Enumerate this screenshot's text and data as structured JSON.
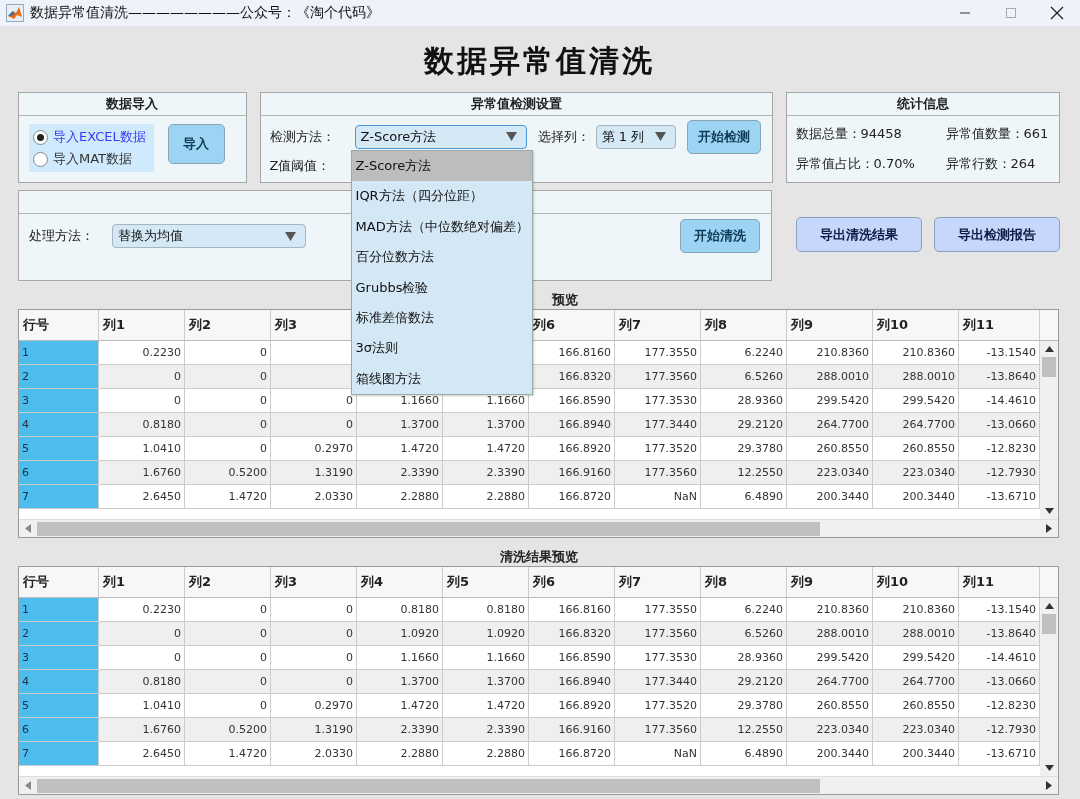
{
  "window": {
    "title": "数据异常值清洗————————公众号：《淘个代码》"
  },
  "heading": "数据异常值清洗",
  "import_panel": {
    "title": "数据导入",
    "options": [
      {
        "label": "导入EXCEL数据",
        "selected": true
      },
      {
        "label": "导入MAT数据",
        "selected": false
      }
    ],
    "button": "导入"
  },
  "detect_panel": {
    "title": "异常值检测设置",
    "method_label": "检测方法：",
    "method_value": "Z-Score方法",
    "column_label": "选择列：",
    "column_value": "第 1 列",
    "threshold_label": "Z值阈值：",
    "button": "开始检测",
    "dropdown": {
      "expanded": true,
      "options": [
        {
          "label": "Z-Score方法",
          "selected": true
        },
        {
          "label": "IQR方法（四分位距）",
          "selected": false
        },
        {
          "label": "MAD方法（中位数绝对偏差）",
          "selected": false
        },
        {
          "label": "百分位数方法",
          "selected": false
        },
        {
          "label": "Grubbs检验",
          "selected": false
        },
        {
          "label": "标准差倍数法",
          "selected": false
        },
        {
          "label": "3σ法则",
          "selected": false
        },
        {
          "label": "箱线图方法",
          "selected": false
        }
      ]
    }
  },
  "clean_panel": {
    "method_label": "处理方法：",
    "method_value": "替换为均值",
    "button": "开始清洗"
  },
  "stats_panel": {
    "title": "统计信息",
    "items": [
      {
        "label": "数据总量：",
        "value": "94458"
      },
      {
        "label": "异常值数量：",
        "value": "661"
      },
      {
        "label": "异常值占比：",
        "value": "0.70%"
      },
      {
        "label": "异常行数：",
        "value": "264"
      }
    ]
  },
  "export_buttons": [
    "导出清洗结果",
    "导出检测报告"
  ],
  "tables": [
    {
      "title": "预览",
      "columns": [
        "行号",
        "列1",
        "列2",
        "列3",
        null,
        null,
        "列6",
        "列7",
        "列8",
        "列9",
        "列10",
        "列11"
      ],
      "rows": [
        [
          "1",
          "0.2230",
          "0",
          null,
          null,
          null,
          "166.8160",
          "177.3550",
          "6.2240",
          "210.8360",
          "210.8360",
          "-13.1540"
        ],
        [
          "2",
          "0",
          "0",
          null,
          null,
          null,
          "166.8320",
          "177.3560",
          "6.5260",
          "288.0010",
          "288.0010",
          "-13.8640"
        ],
        [
          "3",
          "0",
          "0",
          "0",
          "1.1660",
          "1.1660",
          "166.8590",
          "177.3530",
          "28.9360",
          "299.5420",
          "299.5420",
          "-14.4610"
        ],
        [
          "4",
          "0.8180",
          "0",
          "0",
          "1.3700",
          "1.3700",
          "166.8940",
          "177.3440",
          "29.2120",
          "264.7700",
          "264.7700",
          "-13.0660"
        ],
        [
          "5",
          "1.0410",
          "0",
          "0.2970",
          "1.4720",
          "1.4720",
          "166.8920",
          "177.3520",
          "29.3780",
          "260.8550",
          "260.8550",
          "-12.8230"
        ],
        [
          "6",
          "1.6760",
          "0.5200",
          "1.3190",
          "2.3390",
          "2.3390",
          "166.9160",
          "177.3560",
          "12.2550",
          "223.0340",
          "223.0340",
          "-12.7930"
        ],
        [
          "7",
          "2.6450",
          "1.4720",
          "2.0330",
          "2.2880",
          "2.2880",
          "166.8720",
          "NaN",
          "6.4890",
          "200.3440",
          "200.3440",
          "-13.6710"
        ]
      ]
    },
    {
      "title": "清洗结果预览",
      "columns": [
        "行号",
        "列1",
        "列2",
        "列3",
        "列4",
        "列5",
        "列6",
        "列7",
        "列8",
        "列9",
        "列10",
        "列11"
      ],
      "rows": [
        [
          "1",
          "0.2230",
          "0",
          "0",
          "0.8180",
          "0.8180",
          "166.8160",
          "177.3550",
          "6.2240",
          "210.8360",
          "210.8360",
          "-13.1540"
        ],
        [
          "2",
          "0",
          "0",
          "0",
          "1.0920",
          "1.0920",
          "166.8320",
          "177.3560",
          "6.5260",
          "288.0010",
          "288.0010",
          "-13.8640"
        ],
        [
          "3",
          "0",
          "0",
          "0",
          "1.1660",
          "1.1660",
          "166.8590",
          "177.3530",
          "28.9360",
          "299.5420",
          "299.5420",
          "-14.4610"
        ],
        [
          "4",
          "0.8180",
          "0",
          "0",
          "1.3700",
          "1.3700",
          "166.8940",
          "177.3440",
          "29.2120",
          "264.7700",
          "264.7700",
          "-13.0660"
        ],
        [
          "5",
          "1.0410",
          "0",
          "0.2970",
          "1.4720",
          "1.4720",
          "166.8920",
          "177.3520",
          "29.3780",
          "260.8550",
          "260.8550",
          "-12.8230"
        ],
        [
          "6",
          "1.6760",
          "0.5200",
          "1.3190",
          "2.3390",
          "2.3390",
          "166.9160",
          "177.3560",
          "12.2550",
          "223.0340",
          "223.0340",
          "-12.7930"
        ],
        [
          "7",
          "2.6450",
          "1.4720",
          "2.0330",
          "2.2880",
          "2.2880",
          "166.8720",
          "NaN",
          "6.4890",
          "200.3440",
          "200.3440",
          "-13.6710"
        ]
      ]
    }
  ]
}
